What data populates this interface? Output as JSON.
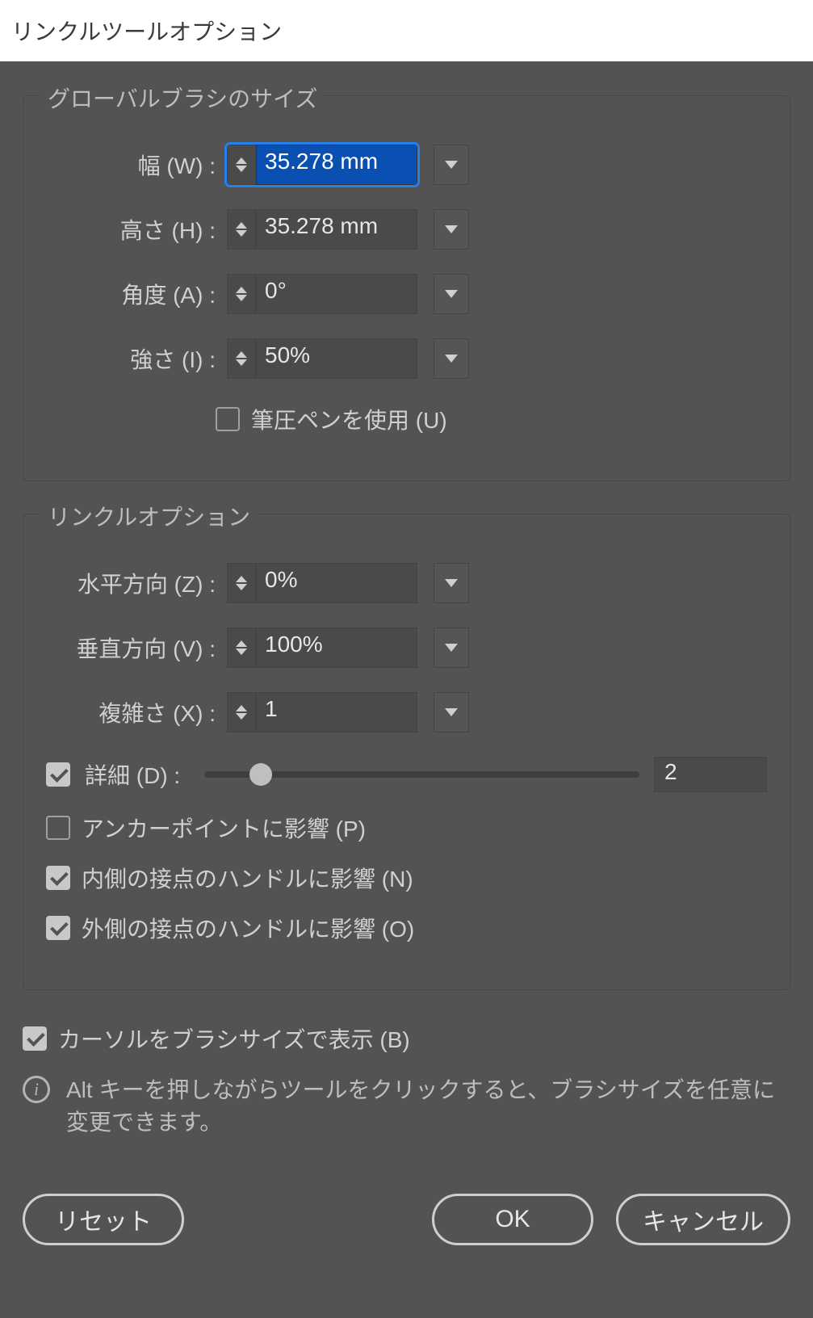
{
  "dialog": {
    "title": "リンクルツールオプション"
  },
  "brush": {
    "legend": "グローバルブラシのサイズ",
    "width_label": "幅 (W) :",
    "width_value": "35.278 mm",
    "height_label": "高さ (H) :",
    "height_value": "35.278 mm",
    "angle_label": "角度 (A) :",
    "angle_value": "0°",
    "intensity_label": "強さ (I) :",
    "intensity_value": "50%",
    "pressure_label": "筆圧ペンを使用 (U)"
  },
  "wrinkle": {
    "legend": "リンクルオプション",
    "horizontal_label": "水平方向 (Z) :",
    "horizontal_value": "0%",
    "vertical_label": "垂直方向 (V) :",
    "vertical_value": "100%",
    "complexity_label": "複雑さ (X) :",
    "complexity_value": "1",
    "detail_label": "詳細 (D) :",
    "detail_value": "2",
    "anchor_label": "アンカーポイントに影響 (P)",
    "in_handle_label": "内側の接点のハンドルに影響 (N)",
    "out_handle_label": "外側の接点のハンドルに影響 (O)"
  },
  "cursor": {
    "label": "カーソルをブラシサイズで表示 (B)"
  },
  "info": {
    "text": "Alt キーを押しながらツールをクリックすると、ブラシサイズを任意に変更できます。"
  },
  "buttons": {
    "reset": "リセット",
    "ok": "OK",
    "cancel": "キャンセル"
  }
}
